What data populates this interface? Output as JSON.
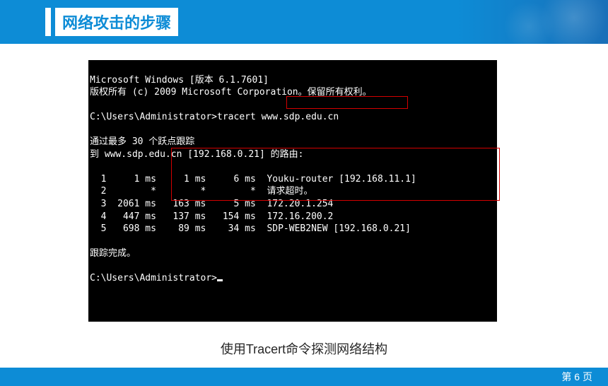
{
  "slide": {
    "title": "网络攻击的步骤",
    "caption": "使用Tracert命令探测网络结构",
    "page_label": "第 6 页"
  },
  "terminal": {
    "line1": "Microsoft Windows [版本 6.1.7601]",
    "line2": "版权所有 (c) 2009 Microsoft Corporation。保留所有权利。",
    "prompt1": "C:\\Users\\Administrator>",
    "command": "tracert www.sdp.edu.cn",
    "msg1": "通过最多 30 个跃点跟踪",
    "msg2": "到 www.sdp.edu.cn [192.168.0.21] 的路由:",
    "hops": [
      {
        "n": "1",
        "c1": "1 ms",
        "c2": "1 ms",
        "c3": "6 ms",
        "host": "Youku-router [192.168.11.1]"
      },
      {
        "n": "2",
        "c1": "*",
        "c2": "*",
        "c3": "*",
        "host": "请求超时。"
      },
      {
        "n": "3",
        "c1": "2061 ms",
        "c2": "163 ms",
        "c3": "5 ms",
        "host": "172.20.1.254"
      },
      {
        "n": "4",
        "c1": "447 ms",
        "c2": "137 ms",
        "c3": "154 ms",
        "host": "172.16.200.2"
      },
      {
        "n": "5",
        "c1": "698 ms",
        "c2": "89 ms",
        "c3": "34 ms",
        "host": "SDP-WEB2NEW [192.168.0.21]"
      }
    ],
    "done": "跟踪完成。",
    "prompt2": "C:\\Users\\Administrator>"
  }
}
